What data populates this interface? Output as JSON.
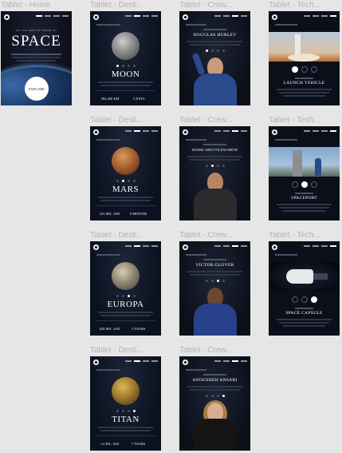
{
  "frames": {
    "home": {
      "label": "Tablet - Home",
      "kicker": "SO, YOU WANT TO TRAVEL TO",
      "title": "SPACE",
      "button": "EXPLORE"
    },
    "dest_moon": {
      "label": "Tablet - Desti...",
      "title": "MOON",
      "distance": "384,400 KM",
      "time": "3 DAYS"
    },
    "dest_mars": {
      "label": "Tablet - Desti...",
      "title": "MARS",
      "distance": "225 MIL. KM",
      "time": "9 MONTHS"
    },
    "dest_europa": {
      "label": "Tablet - Desti...",
      "title": "EUROPA",
      "distance": "628 MIL. KM",
      "time": "3 YEARS"
    },
    "dest_titan": {
      "label": "Tablet - Desti...",
      "title": "TITAN",
      "distance": "1.6 BIL. KM",
      "time": "7 YEARS"
    },
    "crew_1": {
      "label": "Tablet - Crew...",
      "name": "DOUGLAS HURLEY"
    },
    "crew_2": {
      "label": "Tablet - Crew...",
      "name": "MARK SHUTTLEWORTH"
    },
    "crew_3": {
      "label": "Tablet - Crew...",
      "name": "VICTOR GLOVER"
    },
    "crew_4": {
      "label": "Tablet - Crew...",
      "name": "ANOUSHEH ANSARI"
    },
    "tech_1": {
      "label": "Tablet - Tech...",
      "name": "LAUNCH VEHICLE"
    },
    "tech_2": {
      "label": "Tablet - Tech...",
      "name": "SPACEPORT"
    },
    "tech_3": {
      "label": "Tablet - Tech...",
      "name": "SPACE CAPSULE"
    }
  },
  "colors": {
    "canvas": "#e6e6e6",
    "card": "#0b0d17",
    "label": "#b3b3b3"
  }
}
